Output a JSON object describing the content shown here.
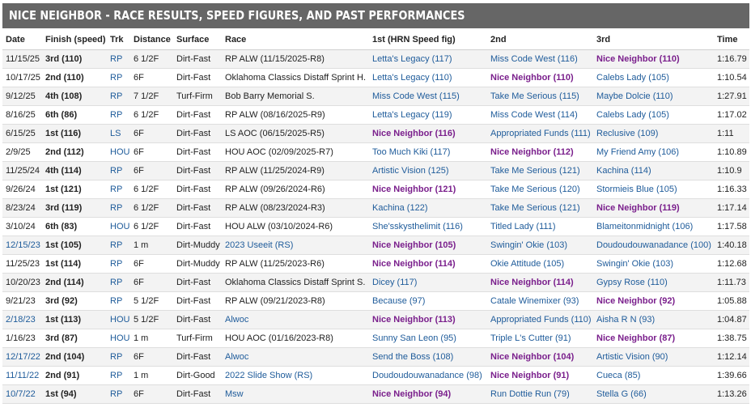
{
  "page_title": "NICE NEIGHBOR - RACE RESULTS, SPEED FIGURES, AND PAST PERFORMANCES",
  "columns": [
    "Date",
    "Finish (speed)",
    "Trk",
    "Distance",
    "Surface",
    "Race",
    "1st (HRN Speed fig)",
    "2nd",
    "3rd",
    "Time"
  ],
  "colors": {
    "header_bar": "#666666",
    "link": "#1e5b9a",
    "highlight": "#7a1f8c",
    "row_alt": "#f3f3f3"
  },
  "rows": [
    {
      "date": "11/15/25",
      "date_link": false,
      "finish": "3rd (110)",
      "trk": "RP",
      "distance": "6 1/2F",
      "surface": "Dirt-Fast",
      "race": "RP ALW (11/15/2025-R8)",
      "race_link": false,
      "first": "Letta's Legacy (117)",
      "second": "Miss Code West (116)",
      "third": "Nice Neighbor (110)",
      "time": "1:16.79",
      "hl": 3
    },
    {
      "date": "10/17/25",
      "date_link": false,
      "finish": "2nd (110)",
      "trk": "RP",
      "distance": "6F",
      "surface": "Dirt-Fast",
      "race": "Oklahoma Classics Distaff Sprint H.",
      "race_link": false,
      "first": "Letta's Legacy (110)",
      "second": "Nice Neighbor (110)",
      "third": "Calebs Lady (105)",
      "time": "1:10.54",
      "hl": 2
    },
    {
      "date": "9/12/25",
      "date_link": false,
      "finish": "4th (108)",
      "trk": "RP",
      "distance": "7 1/2F",
      "surface": "Turf-Firm",
      "race": "Bob Barry Memorial S.",
      "race_link": false,
      "first": "Miss Code West (115)",
      "second": "Take Me Serious (115)",
      "third": "Maybe Dolcie (110)",
      "time": "1:27.91",
      "hl": 0
    },
    {
      "date": "8/16/25",
      "date_link": false,
      "finish": "6th (86)",
      "trk": "RP",
      "distance": "6 1/2F",
      "surface": "Dirt-Fast",
      "race": "RP ALW (08/16/2025-R9)",
      "race_link": false,
      "first": "Letta's Legacy (119)",
      "second": "Miss Code West (114)",
      "third": "Calebs Lady (105)",
      "time": "1:17.02",
      "hl": 0
    },
    {
      "date": "6/15/25",
      "date_link": false,
      "finish": "1st (116)",
      "trk": "LS",
      "distance": "6F",
      "surface": "Dirt-Fast",
      "race": "LS AOC (06/15/2025-R5)",
      "race_link": false,
      "first": "Nice Neighbor (116)",
      "second": "Appropriated Funds (111)",
      "third": "Reclusive (109)",
      "time": "1:11",
      "hl": 1
    },
    {
      "date": "2/9/25",
      "date_link": false,
      "finish": "2nd (112)",
      "trk": "HOU",
      "distance": "6F",
      "surface": "Dirt-Fast",
      "race": "HOU AOC (02/09/2025-R7)",
      "race_link": false,
      "first": "Too Much Kiki (117)",
      "second": "Nice Neighbor (112)",
      "third": "My Friend Amy (106)",
      "time": "1:10.89",
      "hl": 2
    },
    {
      "date": "11/25/24",
      "date_link": false,
      "finish": "4th (114)",
      "trk": "RP",
      "distance": "6F",
      "surface": "Dirt-Fast",
      "race": "RP ALW (11/25/2024-R9)",
      "race_link": false,
      "first": "Artistic Vision (125)",
      "second": "Take Me Serious (121)",
      "third": "Kachina (114)",
      "time": "1:10.9",
      "hl": 0
    },
    {
      "date": "9/26/24",
      "date_link": false,
      "finish": "1st (121)",
      "trk": "RP",
      "distance": "6 1/2F",
      "surface": "Dirt-Fast",
      "race": "RP ALW (09/26/2024-R6)",
      "race_link": false,
      "first": "Nice Neighbor (121)",
      "second": "Take Me Serious (120)",
      "third": "Stormieis Blue (105)",
      "time": "1:16.33",
      "hl": 1
    },
    {
      "date": "8/23/24",
      "date_link": false,
      "finish": "3rd (119)",
      "trk": "RP",
      "distance": "6 1/2F",
      "surface": "Dirt-Fast",
      "race": "RP ALW (08/23/2024-R3)",
      "race_link": false,
      "first": "Kachina (122)",
      "second": "Take Me Serious (121)",
      "third": "Nice Neighbor (119)",
      "time": "1:17.14",
      "hl": 3
    },
    {
      "date": "3/10/24",
      "date_link": false,
      "finish": "6th (83)",
      "trk": "HOU",
      "distance": "6 1/2F",
      "surface": "Dirt-Fast",
      "race": "HOU ALW (03/10/2024-R6)",
      "race_link": false,
      "first": "She'sskysthelimit (116)",
      "second": "Titled Lady (111)",
      "third": "Blameitonmidnight (106)",
      "time": "1:17.58",
      "hl": 0
    },
    {
      "date": "12/15/23",
      "date_link": true,
      "finish": "1st (105)",
      "trk": "RP",
      "distance": "1 m",
      "surface": "Dirt-Muddy",
      "race": "2023 Useeit (RS)",
      "race_link": true,
      "first": "Nice Neighbor (105)",
      "second": "Swingin' Okie (103)",
      "third": "Doudoudouwanadance (100)",
      "time": "1:40.18",
      "hl": 1
    },
    {
      "date": "11/25/23",
      "date_link": false,
      "finish": "1st (114)",
      "trk": "RP",
      "distance": "6F",
      "surface": "Dirt-Muddy",
      "race": "RP ALW (11/25/2023-R6)",
      "race_link": false,
      "first": "Nice Neighbor (114)",
      "second": "Okie Attitude (105)",
      "third": "Swingin' Okie (103)",
      "time": "1:12.68",
      "hl": 1
    },
    {
      "date": "10/20/23",
      "date_link": false,
      "finish": "2nd (114)",
      "trk": "RP",
      "distance": "6F",
      "surface": "Dirt-Fast",
      "race": "Oklahoma Classics Distaff Sprint S.",
      "race_link": false,
      "first": "Dicey (117)",
      "second": "Nice Neighbor (114)",
      "third": "Gypsy Rose (110)",
      "time": "1:11.73",
      "hl": 2
    },
    {
      "date": "9/21/23",
      "date_link": false,
      "finish": "3rd (92)",
      "trk": "RP",
      "distance": "5 1/2F",
      "surface": "Dirt-Fast",
      "race": "RP ALW (09/21/2023-R8)",
      "race_link": false,
      "first": "Because (97)",
      "second": "Catale Winemixer (93)",
      "third": "Nice Neighbor (92)",
      "time": "1:05.88",
      "hl": 3
    },
    {
      "date": "2/18/23",
      "date_link": true,
      "finish": "1st (113)",
      "trk": "HOU",
      "distance": "5 1/2F",
      "surface": "Dirt-Fast",
      "race": "Alwoc",
      "race_link": true,
      "first": "Nice Neighbor (113)",
      "second": "Appropriated Funds (110)",
      "third": "Aisha R N (93)",
      "time": "1:04.87",
      "hl": 1
    },
    {
      "date": "1/16/23",
      "date_link": false,
      "finish": "3rd (87)",
      "trk": "HOU",
      "distance": "1 m",
      "surface": "Turf-Firm",
      "race": "HOU AOC (01/16/2023-R8)",
      "race_link": false,
      "first": "Sunny San Leon (95)",
      "second": "Triple L's Cutter (91)",
      "third": "Nice Neighbor (87)",
      "time": "1:38.75",
      "hl": 3
    },
    {
      "date": "12/17/22",
      "date_link": true,
      "finish": "2nd (104)",
      "trk": "RP",
      "distance": "6F",
      "surface": "Dirt-Fast",
      "race": "Alwoc",
      "race_link": true,
      "first": "Send the Boss (108)",
      "second": "Nice Neighbor (104)",
      "third": "Artistic Vision (90)",
      "time": "1:12.14",
      "hl": 2
    },
    {
      "date": "11/11/22",
      "date_link": true,
      "finish": "2nd (91)",
      "trk": "RP",
      "distance": "1 m",
      "surface": "Dirt-Good",
      "race": "2022 Slide Show (RS)",
      "race_link": true,
      "first": "Doudoudouwanadance (98)",
      "second": "Nice Neighbor (91)",
      "third": "Cueca (85)",
      "time": "1:39.66",
      "hl": 2
    },
    {
      "date": "10/7/22",
      "date_link": true,
      "finish": "1st (94)",
      "trk": "RP",
      "distance": "6F",
      "surface": "Dirt-Fast",
      "race": "Msw",
      "race_link": true,
      "first": "Nice Neighbor (94)",
      "second": "Run Dottie Run (79)",
      "third": "Stella G (66)",
      "time": "1:13.26",
      "hl": 1
    }
  ]
}
